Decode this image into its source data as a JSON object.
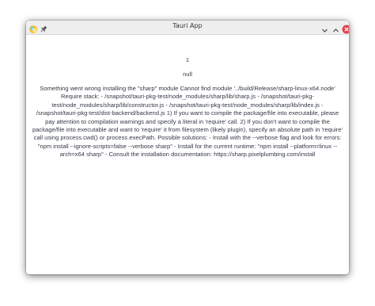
{
  "window": {
    "title": "Tauri App"
  },
  "icons": {
    "app": "tauri-app-icon",
    "pin": "pin-icon",
    "minimize": "chevron-down-icon",
    "maximize": "chevron-up-icon",
    "close": "close-icon"
  },
  "colors": {
    "close_button": "#e0424b",
    "titlebar": "#eeeeee",
    "text": "#333a45"
  },
  "content": {
    "number": "1",
    "null_text": "null",
    "error_message": "Something went wrong installing the \"sharp\" module Cannot find module '../build/Release/sharp-linux-x64.node' Require stack: - /snapshot/tauri-pkg-test/node_modules/sharp/lib/sharp.js - /snapshot/tauri-pkg-test/node_modules/sharp/lib/constructor.js - /snapshot/tauri-pkg-test/node_modules/sharp/lib/index.js - /snapshot/tauri-pkg-test/dist-backend/backend.js 1) If you want to compile the package/file into executable, please pay attention to compilation warnings and specify a literal in 'require' call. 2) If you don't want to compile the package/file into executable and want to 'require' it from filesystem (likely plugin), specify an absolute path in 'require' call using process.cwd() or process.execPath. Possible solutions: - Install with the --verbose flag and look for errors: \"npm install --ignore-scripts=false --verbose sharp\" - Install for the current runtime: \"npm install --platform=linux --arch=x64 sharp\" - Consult the installation documentation: https://sharp.pixelplumbing.com/install"
  }
}
